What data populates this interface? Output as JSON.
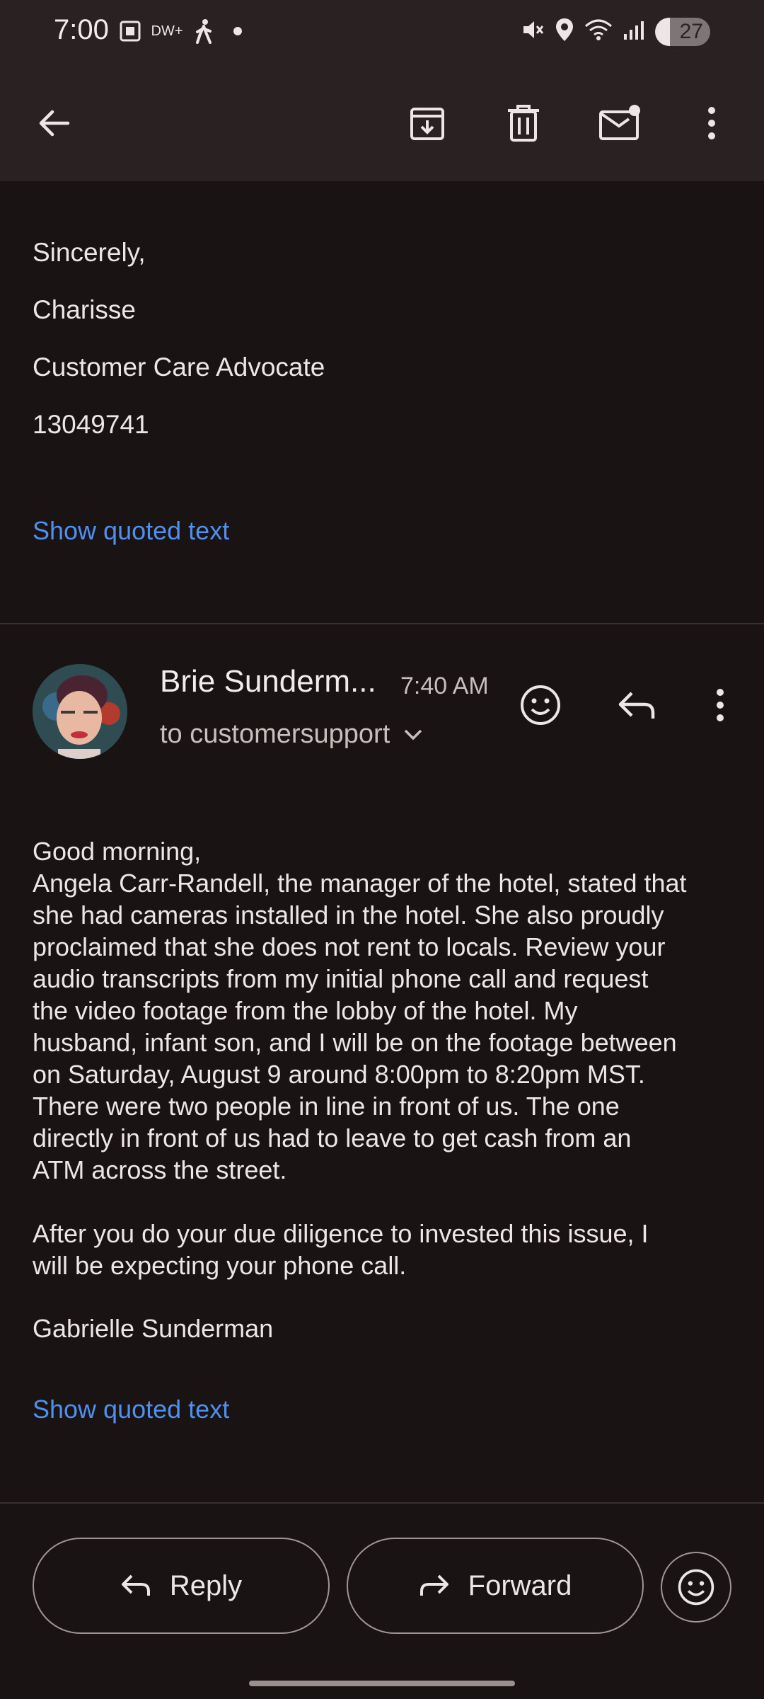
{
  "status_bar": {
    "time": "7:00",
    "battery_level": "27",
    "icons": [
      "screenshot-icon",
      "dw-icon",
      "walking-icon",
      "dot-icon",
      "mute-icon",
      "location-icon",
      "wifi-icon",
      "signal-icon",
      "battery-icon"
    ],
    "dw_label": "DW+"
  },
  "toolbar": {
    "icons": [
      "back-arrow-icon",
      "archive-icon",
      "delete-icon",
      "mark-unread-icon",
      "more-vert-icon"
    ]
  },
  "previous_message": {
    "lines": [
      "Sincerely,",
      "Charisse",
      "Customer Care Advocate",
      "13049741"
    ],
    "show_quoted_label": "Show quoted text"
  },
  "message": {
    "sender": "Brie Sunderm...",
    "time": "7:40 AM",
    "recipient": "to customersupport",
    "body_intro": "Good morning,\nAngela Carr-Randell, the manager of the hotel, stated that\nshe had cameras installed in the hotel. She also proudly\nproclaimed that she does not rent to locals. Review your\naudio transcripts from my initial phone call and request\nthe video footage from the lobby of the hotel. My\nhusband, infant son, and I will be on the footage between\non Saturday, August 9 around 8:00pm to 8:20pm MST.\nThere were two people in line in front of us. The one\ndirectly in front of us had to leave to get cash from an\nATM across the street.",
    "body_followup": "After you do your due diligence to invested this issue, I\nwill be expecting your phone call.",
    "signature": "Gabrielle Sunderman",
    "show_quoted_label": "Show quoted text"
  },
  "bottom_actions": {
    "reply_label": "Reply",
    "forward_label": "Forward"
  },
  "colors": {
    "background": "#1a1313",
    "toolbar": "#2a2222",
    "link": "#4f8ff0",
    "text": "#ece6e6",
    "muted_text": "#c7bebe"
  }
}
